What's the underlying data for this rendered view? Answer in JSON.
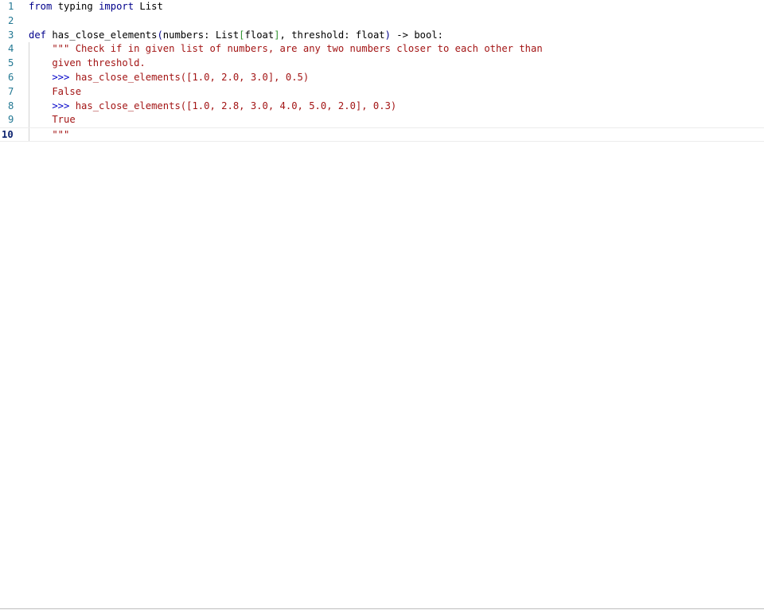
{
  "editor": {
    "lines": [
      {
        "number": "1"
      },
      {
        "number": "2"
      },
      {
        "number": "3"
      },
      {
        "number": "4"
      },
      {
        "number": "5"
      },
      {
        "number": "6"
      },
      {
        "number": "7"
      },
      {
        "number": "8"
      },
      {
        "number": "9"
      },
      {
        "number": "10"
      }
    ],
    "code": {
      "l1": {
        "kw_from": "from",
        "mod": " typing ",
        "kw_import": "import",
        "name": " List"
      },
      "l3": {
        "kw_def": "def",
        "fn": " has_close_elements",
        "lp": "(",
        "p1": "numbers: List",
        "lb": "[",
        "t1": "float",
        "rb": "]",
        "p2": ", threshold: float",
        "rp": ")",
        "ret": " -> bool:"
      },
      "l4": "    \"\"\" Check if in given list of numbers, are any two numbers closer to each other than",
      "l5": "    given threshold.",
      "l6_prompt": "    >>>",
      "l6_rest": " has_close_elements([1.0, 2.0, 3.0], 0.5)",
      "l7": "    False",
      "l8_prompt": "    >>>",
      "l8_rest": " has_close_elements([1.0, 2.8, 3.0, 4.0, 5.0, 2.0], 0.3)",
      "l9": "    True",
      "l10": "    \"\"\""
    }
  }
}
